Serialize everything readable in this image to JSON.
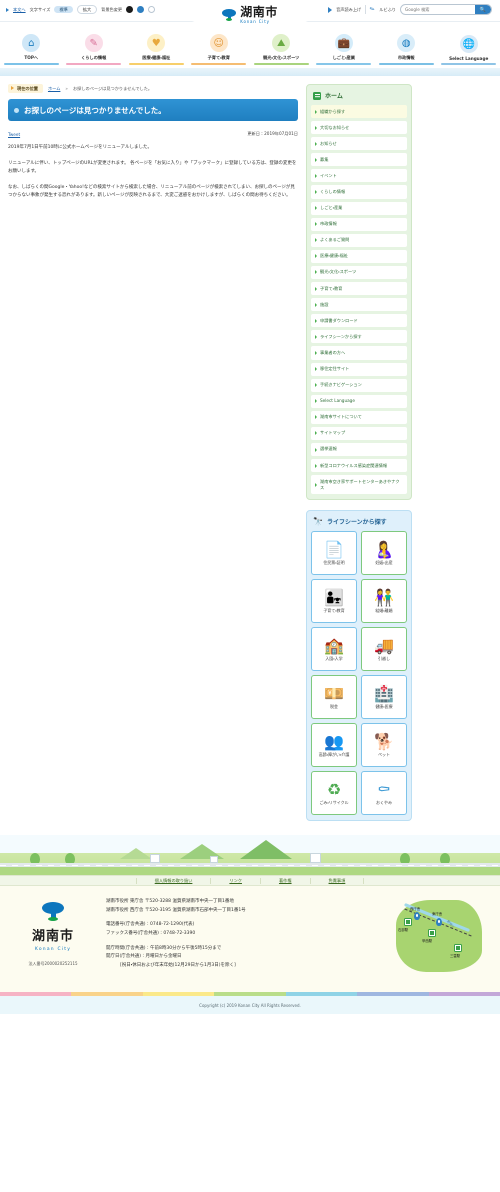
{
  "utility": {
    "skip_link": "本文へ",
    "fontsize_label": "文字サイズ",
    "fontsize_standard": "標準",
    "fontsize_large": "拡大",
    "bgcolor_label": "背景色変更",
    "bg_black": "黒",
    "bg_blue": "青",
    "bg_white": "白",
    "speech_label": "音声読み上げ",
    "ruby_label": "ルビふり",
    "search_placeholder": "Google 検索",
    "search_value": "",
    "search_button": "検索"
  },
  "brand": {
    "name_jp": "湖南市",
    "name_en": "Konan City"
  },
  "gnav": [
    {
      "label": "TOPへ",
      "icon": "home-icon",
      "glyph": "⌂",
      "bg": "#cfe7f7",
      "fg": "#1f7fc0",
      "accent": "#7cc2e8"
    },
    {
      "label": "くらしの情報",
      "icon": "document-icon",
      "glyph": "✎",
      "bg": "#fadde8",
      "fg": "#d86f96",
      "accent": "#f2a8c2"
    },
    {
      "label": "医療・健康・福祉",
      "icon": "heart-icon",
      "glyph": "♥",
      "bg": "#fdf0c6",
      "fg": "#e8a93d",
      "accent": "#f7cf6b"
    },
    {
      "label": "子育て・教育",
      "icon": "child-icon",
      "glyph": "☺",
      "bg": "#fde6c8",
      "fg": "#e0922f",
      "accent": "#f5bd72"
    },
    {
      "label": "観光・文化・スポーツ",
      "icon": "map-icon",
      "glyph": "⛰",
      "bg": "#dff0c9",
      "fg": "#6aab43",
      "accent": "#a9d47e"
    },
    {
      "label": "しごと・産業",
      "icon": "briefcase-icon",
      "glyph": "💼",
      "bg": "#d4ecfa",
      "fg": "#3d9ad4",
      "accent": "#86c6e9"
    },
    {
      "label": "市政情報",
      "icon": "konan-mark-icon",
      "glyph": "◍",
      "bg": "#d9edf9",
      "fg": "#0d76bd",
      "accent": "#7bc0e5"
    },
    {
      "label": "Select Language",
      "icon": "globe-icon",
      "glyph": "🌐",
      "bg": "#d8e9f7",
      "fg": "#2f7fc1",
      "accent": "#8fc4e6"
    }
  ],
  "breadcrumb": {
    "current_position_label": "現在の位置",
    "home": "ホーム",
    "separator": "»",
    "current": "お探しのページは見つかりませんでした。"
  },
  "page": {
    "title": "お探しのページは見つかりませんでした。",
    "tweet_label": "Tweet",
    "updated_label": "更新日：2019年07月01日",
    "paragraphs": [
      "2019年7月1日午前10時に公式ホームページをリニューアルしました。",
      "リニューアルに伴い、トップページのURLが変更されます。 各ページを「お気に入り」や「ブックマーク」に登録している方は、登録の変更をお願いします。",
      "なお、しばらくの間Google・Yahoo!などの検索サイトから検索した場合、リニューアル前のページが検索されてしまい、お探しのページが見つからない事象が発生する恐れがあります。新しいページが反映されるまで、大変ご迷惑をおかけしますが、しばらくの間お待ちください。"
    ]
  },
  "sidebar": {
    "title": "ホーム",
    "items": [
      {
        "label": "組織から探す",
        "active": true
      },
      {
        "label": "大切なお知らせ",
        "active": false
      },
      {
        "label": "お知らせ",
        "active": false
      },
      {
        "label": "募集",
        "active": false
      },
      {
        "label": "イベント",
        "active": false
      },
      {
        "label": "くらしの情報",
        "active": false
      },
      {
        "label": "しごと・産業",
        "active": false
      },
      {
        "label": "市政情報",
        "active": false
      },
      {
        "label": "よくあるご質問",
        "active": false
      },
      {
        "label": "医療・健康・福祉",
        "active": false
      },
      {
        "label": "観光・文化・スポーツ",
        "active": false
      },
      {
        "label": "子育て・教育",
        "active": false
      },
      {
        "label": "施設",
        "active": false
      },
      {
        "label": "申請書ダウンロード",
        "active": false
      },
      {
        "label": "ライフシーンから探す",
        "active": false
      },
      {
        "label": "事業者の方へ",
        "active": false
      },
      {
        "label": "移住定住サイト",
        "active": false
      },
      {
        "label": "手続きナビゲーション",
        "active": false
      },
      {
        "label": "Select Language",
        "active": false
      },
      {
        "label": "湖南市サイトについて",
        "active": false
      },
      {
        "label": "サイトマップ",
        "active": false
      },
      {
        "label": "選挙速報",
        "active": false
      },
      {
        "label": "新型コロナウイルス感染症関連情報",
        "active": false
      },
      {
        "label": "湖南市空き家サポートセンターあきやナクス",
        "active": false
      }
    ]
  },
  "lifescene": {
    "title": "ライフシーンから探す",
    "icon": "binoculars-icon",
    "tiles": [
      {
        "label": "住民票・証明",
        "icon": "document-hand-icon",
        "glyph": "📄",
        "color": "b"
      },
      {
        "label": "妊娠・出産",
        "icon": "pregnancy-icon",
        "glyph": "🤱",
        "color": "g"
      },
      {
        "label": "子育て・教育",
        "icon": "parenting-icon",
        "glyph": "👨‍👧",
        "color": "b"
      },
      {
        "label": "結婚・離婚",
        "icon": "couple-icon",
        "glyph": "👫",
        "color": "g"
      },
      {
        "label": "入園・入学",
        "icon": "school-icon",
        "glyph": "🏫",
        "color": "b"
      },
      {
        "label": "引越し",
        "icon": "moving-truck-icon",
        "glyph": "🚚",
        "color": "g"
      },
      {
        "label": "税金",
        "icon": "money-icon",
        "glyph": "💴",
        "color": "g"
      },
      {
        "label": "健康・医療",
        "icon": "medical-icon",
        "glyph": "🏥",
        "color": "b"
      },
      {
        "label": "高齢・障がい・介護",
        "icon": "care-icon",
        "glyph": "👥",
        "color": "g"
      },
      {
        "label": "ペット",
        "icon": "pet-icon",
        "glyph": "🐕",
        "color": "b"
      },
      {
        "label": "ごみ・リサイクル",
        "icon": "recycle-icon",
        "glyph": "♻",
        "color": "g"
      },
      {
        "label": "おくやみ",
        "icon": "condolence-icon",
        "glyph": "⚰",
        "color": "b"
      }
    ]
  },
  "footer": {
    "links": [
      "個人情報の取り扱い",
      "リンク",
      "著作権",
      "免責事項"
    ],
    "logo_jp": "湖南市",
    "logo_en": "Konan City",
    "corporate_number": "法人番号2000020252115",
    "address_east": "湖南市役所 東庁舎 〒520-3288 滋賀県湖南市中央一丁目1番地",
    "address_west": "湖南市役所 西庁舎 〒520-3195 滋賀県湖南市石部中央一丁目1番1号",
    "tel": "電話番号(庁舎共通)：0748-72-1290(代表)",
    "fax": "ファックス番号(庁舎共通)：0748-72-3390",
    "hours": "開庁時間(庁舎共通)：午前8時30分から午後5時15分まで",
    "days": "開庁日(庁舎共通)：月曜日から金曜日",
    "holidays": "[祝日・休日および年末年始(12月29日から1月3日)を除く]",
    "map": {
      "stations": [
        "石部駅",
        "甲西駅",
        "三雲駅"
      ],
      "offices": [
        "西庁舎",
        "東庁舎"
      ],
      "river": "野洲川"
    },
    "copyright": "Copyright (c) 2019 Konan City All Rights Reserved."
  }
}
